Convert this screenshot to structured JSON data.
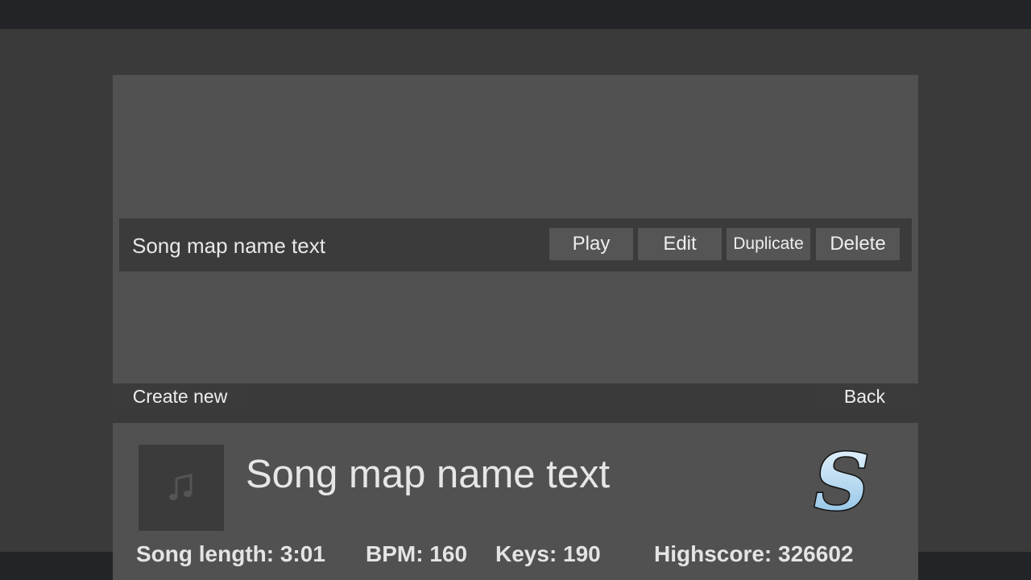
{
  "song_list": {
    "rows": [
      {
        "name": "Song map name text",
        "buttons": {
          "play": "Play",
          "edit": "Edit",
          "duplicate": "Duplicate",
          "delete": "Delete"
        }
      }
    ]
  },
  "actions": {
    "create_new": "Create new",
    "back": "Back"
  },
  "details": {
    "title": "Song map name text",
    "cover_icon": "music-note-icon",
    "rank_letter": "S",
    "song_length": "Song length: 3:01",
    "bpm": "BPM: 160",
    "keys": "Keys: 190",
    "highscore": "Highscore: 326602"
  },
  "colors": {
    "background": "#3a3a3a",
    "top_bar": "#232428",
    "panel": "#515151",
    "row": "#3b3b3b",
    "button": "#555555",
    "rank_gradient_top": "#e8f4ff",
    "rank_gradient_bottom": "#8ec3e6"
  }
}
